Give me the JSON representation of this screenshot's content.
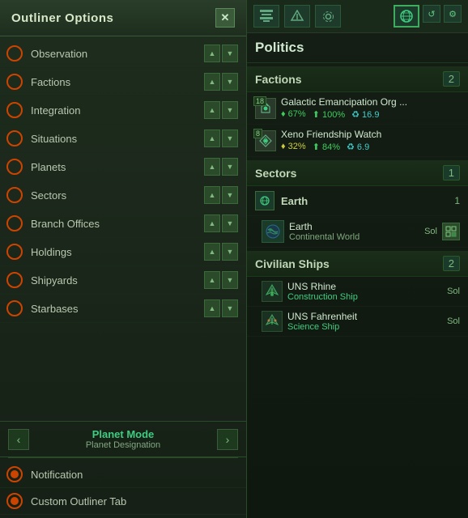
{
  "left_panel": {
    "title": "Outliner Options",
    "close_label": "✕",
    "items": [
      {
        "id": "observation",
        "label": "Observation",
        "active": false
      },
      {
        "id": "factions",
        "label": "Factions",
        "active": false
      },
      {
        "id": "integration",
        "label": "Integration",
        "active": false
      },
      {
        "id": "situations",
        "label": "Situations",
        "active": false
      },
      {
        "id": "planets",
        "label": "Planets",
        "active": false
      },
      {
        "id": "sectors",
        "label": "Sectors",
        "active": false
      },
      {
        "id": "branch-offices",
        "label": "Branch Offices",
        "active": false
      },
      {
        "id": "holdings",
        "label": "Holdings",
        "active": false
      },
      {
        "id": "shipyards",
        "label": "Shipyards",
        "active": false
      },
      {
        "id": "starbases",
        "label": "Starbases",
        "active": false
      }
    ],
    "planet_mode": {
      "label": "Planet Mode",
      "sub": "Planet Designation"
    },
    "bottom_items": [
      {
        "id": "notification",
        "label": "Notification",
        "active": true
      },
      {
        "id": "custom-tab",
        "label": "Custom Outliner Tab",
        "active": true
      }
    ]
  },
  "right_panel": {
    "icons": {
      "column": "🏛",
      "ship": "🚀",
      "gear": "⚙",
      "globe": "🌐"
    },
    "politics_title": "Politics",
    "sections": {
      "factions": {
        "label": "Factions",
        "count": "2",
        "items": [
          {
            "name": "Galactic Emancipation Org ...",
            "num": "18",
            "stats": [
              {
                "icon": "♦",
                "value": "67%",
                "color": "green"
              },
              {
                "icon": "⬆",
                "value": "100%",
                "color": "green"
              },
              {
                "icon": "♻",
                "value": "16.9",
                "color": "teal"
              }
            ]
          },
          {
            "name": "Xeno Friendship Watch",
            "num": "8",
            "stats": [
              {
                "icon": "♦",
                "value": "32%",
                "color": "yellow"
              },
              {
                "icon": "⬆",
                "value": "84%",
                "color": "green"
              },
              {
                "icon": "♻",
                "value": "6.9",
                "color": "teal"
              }
            ]
          }
        ]
      },
      "sectors": {
        "label": "Sectors",
        "count": "1",
        "items": [
          {
            "name": "Earth",
            "count": "1",
            "planets": [
              {
                "name": "Earth",
                "type": "Continental World",
                "location": "Sol",
                "action_icon": "🏭"
              }
            ]
          }
        ]
      },
      "civilian_ships": {
        "label": "Civilian Ships",
        "count": "2",
        "items": [
          {
            "name": "UNS Rhine",
            "type": "Construction Ship",
            "location": "Sol"
          },
          {
            "name": "UNS Fahrenheit",
            "type": "Science Ship",
            "location": "Sol"
          }
        ]
      }
    }
  }
}
